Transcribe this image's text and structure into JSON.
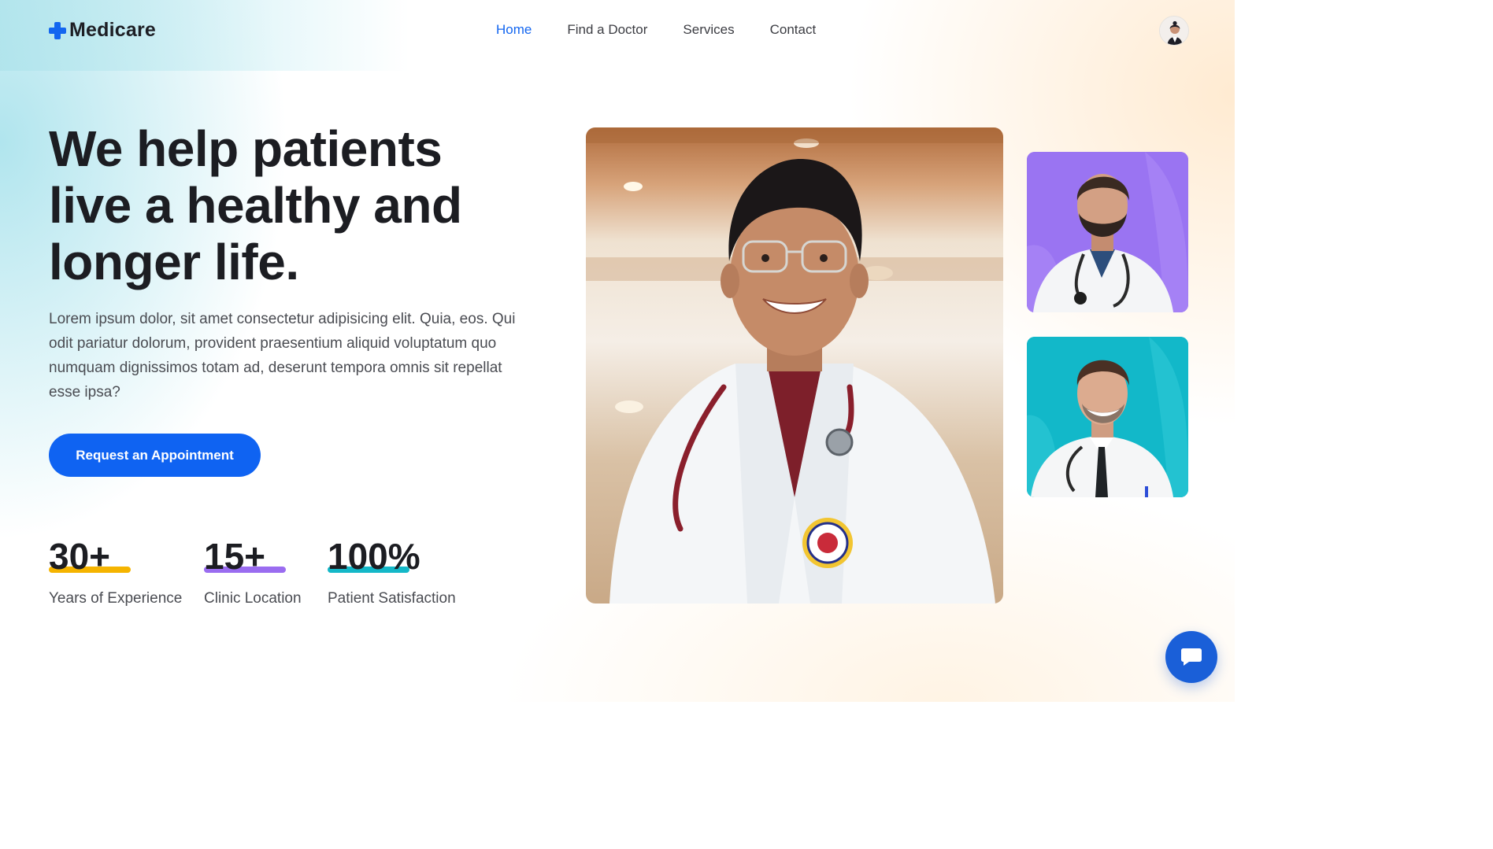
{
  "header": {
    "logo_text": "Medicare",
    "nav": [
      {
        "label": "Home",
        "active": true
      },
      {
        "label": "Find a Doctor",
        "active": false
      },
      {
        "label": "Services",
        "active": false
      },
      {
        "label": "Contact",
        "active": false
      }
    ],
    "avatar_icon": "user-avatar"
  },
  "hero": {
    "title_lines": [
      "We help patients",
      "live a healthy and",
      "longer life."
    ],
    "description": "Lorem ipsum dolor, sit amet consectetur adipisicing elit. Quia, eos. Qui odit pariatur dolorum, provident praesentium aliquid voluptatum quo numquam dignissimos totam ad, deserunt tempora omnis sit repellat esse ipsa?",
    "cta_label": "Request an Appointment"
  },
  "stats": [
    {
      "value": "30+",
      "label": "Years of Experience",
      "color": "#f5b400"
    },
    {
      "value": "15+",
      "label": "Clinic Location",
      "color": "#9a6cf0"
    },
    {
      "value": "100%",
      "label": "Patient Satisfaction",
      "color": "#14b8c8"
    }
  ],
  "colors": {
    "primary": "#0f63f2",
    "side_photo_1_bg": "#9a74f2",
    "side_photo_2_bg": "#12b8c9"
  },
  "chat": {
    "icon": "chat-icon"
  }
}
